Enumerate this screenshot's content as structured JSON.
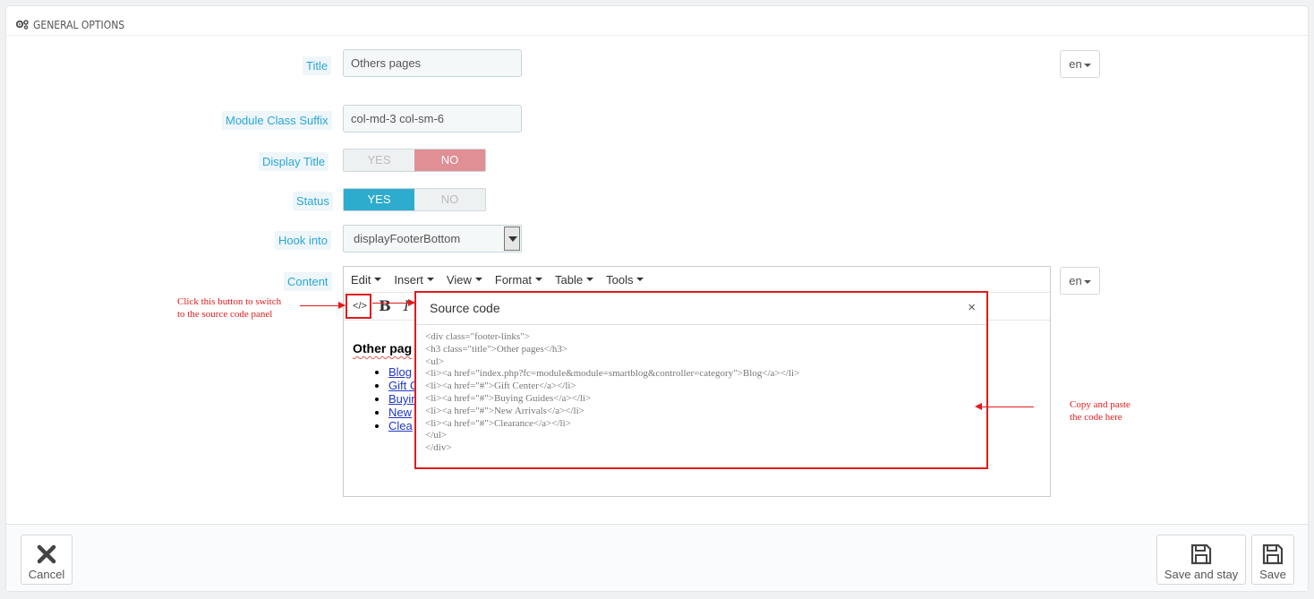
{
  "panel": {
    "heading": "GENERAL OPTIONS"
  },
  "fields": {
    "title": {
      "label": "Title",
      "value": "Others pages",
      "lang": "en"
    },
    "module_class_suffix": {
      "label": "Module Class Suffix",
      "value": "col-md-3 col-sm-6"
    },
    "display_title": {
      "label": "Display Title",
      "yes": "YES",
      "no": "NO",
      "selected": "NO"
    },
    "status": {
      "label": "Status",
      "yes": "YES",
      "no": "NO",
      "selected": "YES"
    },
    "hook_into": {
      "label": "Hook into",
      "value": "displayFooterBottom"
    },
    "content": {
      "label": "Content",
      "lang": "en"
    }
  },
  "editor": {
    "menu": [
      "Edit",
      "Insert",
      "View",
      "Format",
      "Table",
      "Tools"
    ],
    "toolbar": {
      "source_code": "</>",
      "bold": "B",
      "italic": "I"
    },
    "content": {
      "heading": "Other pag",
      "items": [
        "Blog",
        "Gift C",
        "Buyin",
        "New",
        "Clea"
      ]
    }
  },
  "source_modal": {
    "title": "Source code",
    "close": "×",
    "code_lines": [
      "<div class=\"footer-links\">",
      "<h3 class=\"title\">Other pages</h3>",
      "<ul>",
      "<li><a href=\"index.php?fc=module&module=smartblog&controller=category\">Blog</a></li>",
      "<li><a href=\"#\">Gift Center</a></li>",
      "<li><a href=\"#\">Buying Guides</a></li>",
      "<li><a href=\"#\">New Arrivals</a></li>",
      "<li><a href=\"#\">Clearance</a></li>",
      "</ul>",
      "</div>"
    ]
  },
  "annotations": {
    "left_line1": "Click this button to switch",
    "left_line2": "to the source code panel",
    "right_line1": "Copy and paste",
    "right_line2": "the code here"
  },
  "footer": {
    "cancel": "Cancel",
    "save_and_stay": "Save and stay",
    "save": "Save"
  },
  "colors": {
    "label_text": "#2aa7d6",
    "no_active": "#e08f95",
    "yes_active": "#2eacce",
    "annotation_red": "#e01b1b"
  }
}
